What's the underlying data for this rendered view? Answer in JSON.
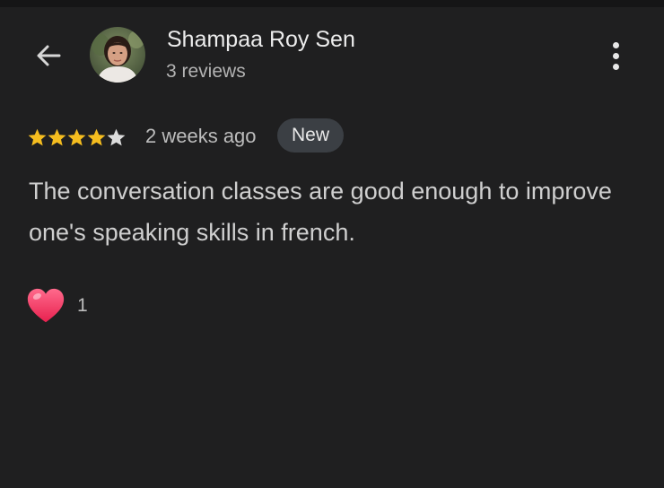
{
  "reviewer": {
    "name": "Shampaa Roy Sen",
    "reviews_count": "3 reviews"
  },
  "review": {
    "rating": 4,
    "max_rating": 5,
    "time": "2 weeks ago",
    "badge": "New",
    "text": "The conversation classes are good enough to improve one's speaking skills in french."
  },
  "reactions": {
    "count": "1"
  },
  "icons": {
    "back": "arrow-left-icon",
    "menu": "more-vert-icon",
    "reaction": "heart-icon"
  },
  "colors": {
    "background": "#1f1f20",
    "star_filled": "#f5bd1f",
    "star_empty": "#dcdcdc",
    "badge_bg": "#3b3f44",
    "heart": "#f0436a"
  }
}
